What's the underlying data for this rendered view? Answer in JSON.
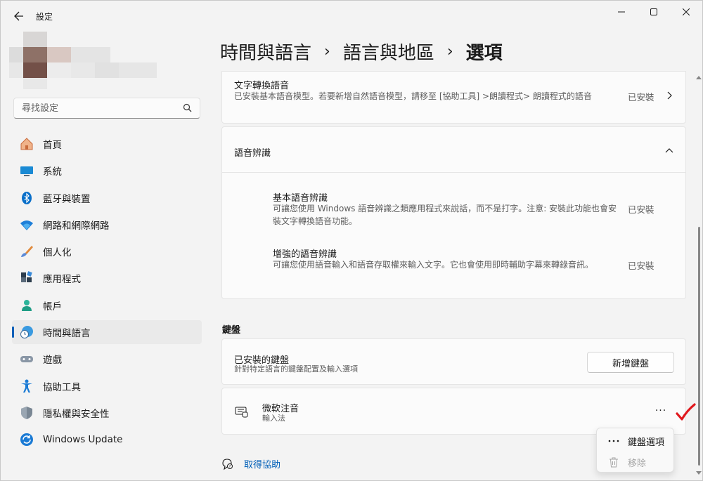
{
  "window": {
    "title": "設定",
    "controls": [
      "minimize",
      "maximize",
      "close"
    ]
  },
  "search": {
    "placeholder": "尋找設定"
  },
  "sidebar": {
    "items": [
      {
        "label": "首頁",
        "icon": "home-icon"
      },
      {
        "label": "系統",
        "icon": "system-icon"
      },
      {
        "label": "藍牙與裝置",
        "icon": "bluetooth-icon"
      },
      {
        "label": "網路和網際網路",
        "icon": "wifi-icon"
      },
      {
        "label": "個人化",
        "icon": "brush-icon"
      },
      {
        "label": "應用程式",
        "icon": "apps-icon"
      },
      {
        "label": "帳戶",
        "icon": "account-icon"
      },
      {
        "label": "時間與語言",
        "icon": "time-language-icon",
        "active": true
      },
      {
        "label": "遊戲",
        "icon": "gaming-icon"
      },
      {
        "label": "協助工具",
        "icon": "accessibility-icon"
      },
      {
        "label": "隱私權與安全性",
        "icon": "shield-icon"
      },
      {
        "label": "Windows Update",
        "icon": "update-icon"
      }
    ]
  },
  "breadcrumb": {
    "level1": "時間與語言",
    "level2": "語言與地區",
    "current": "選項",
    "separator": "›"
  },
  "tts": {
    "title": "文字轉換語音",
    "description": "已安裝基本語音模型。若要新增自然語音模型，請移至 [協助工具] >朗讀程式> 朗讀程式的語音",
    "status": "已安裝"
  },
  "speech_recognition": {
    "title": "語音辨識",
    "items": [
      {
        "title": "基本語音辨識",
        "description": "可讓您使用 Windows 語音辨識之類應用程式來說話，而不是打字。注意: 安裝此功能也會安裝文字轉換語音功能。",
        "status": "已安裝"
      },
      {
        "title": "增強的語音辨識",
        "description": "可讓您使用語音輸入和語音存取權來輸入文字。它也會使用即時輔助字幕來轉錄音訊。",
        "status": "已安裝"
      }
    ]
  },
  "keyboard": {
    "section_label": "鍵盤",
    "installed_title": "已安裝的鍵盤",
    "installed_desc": "針對特定語言的鍵盤配置及輸入選項",
    "add_button": "新增鍵盤",
    "ime": {
      "name": "微軟注音",
      "type": "輸入法",
      "more": "···"
    }
  },
  "context_menu": {
    "items": [
      {
        "label": "鍵盤選項",
        "icon": "more-icon",
        "enabled": true
      },
      {
        "label": "移除",
        "icon": "trash-icon",
        "enabled": false
      }
    ]
  },
  "help": {
    "label": "取得協助"
  },
  "colors": {
    "accent": "#005fb8",
    "annotation_check": "#e0191e"
  }
}
